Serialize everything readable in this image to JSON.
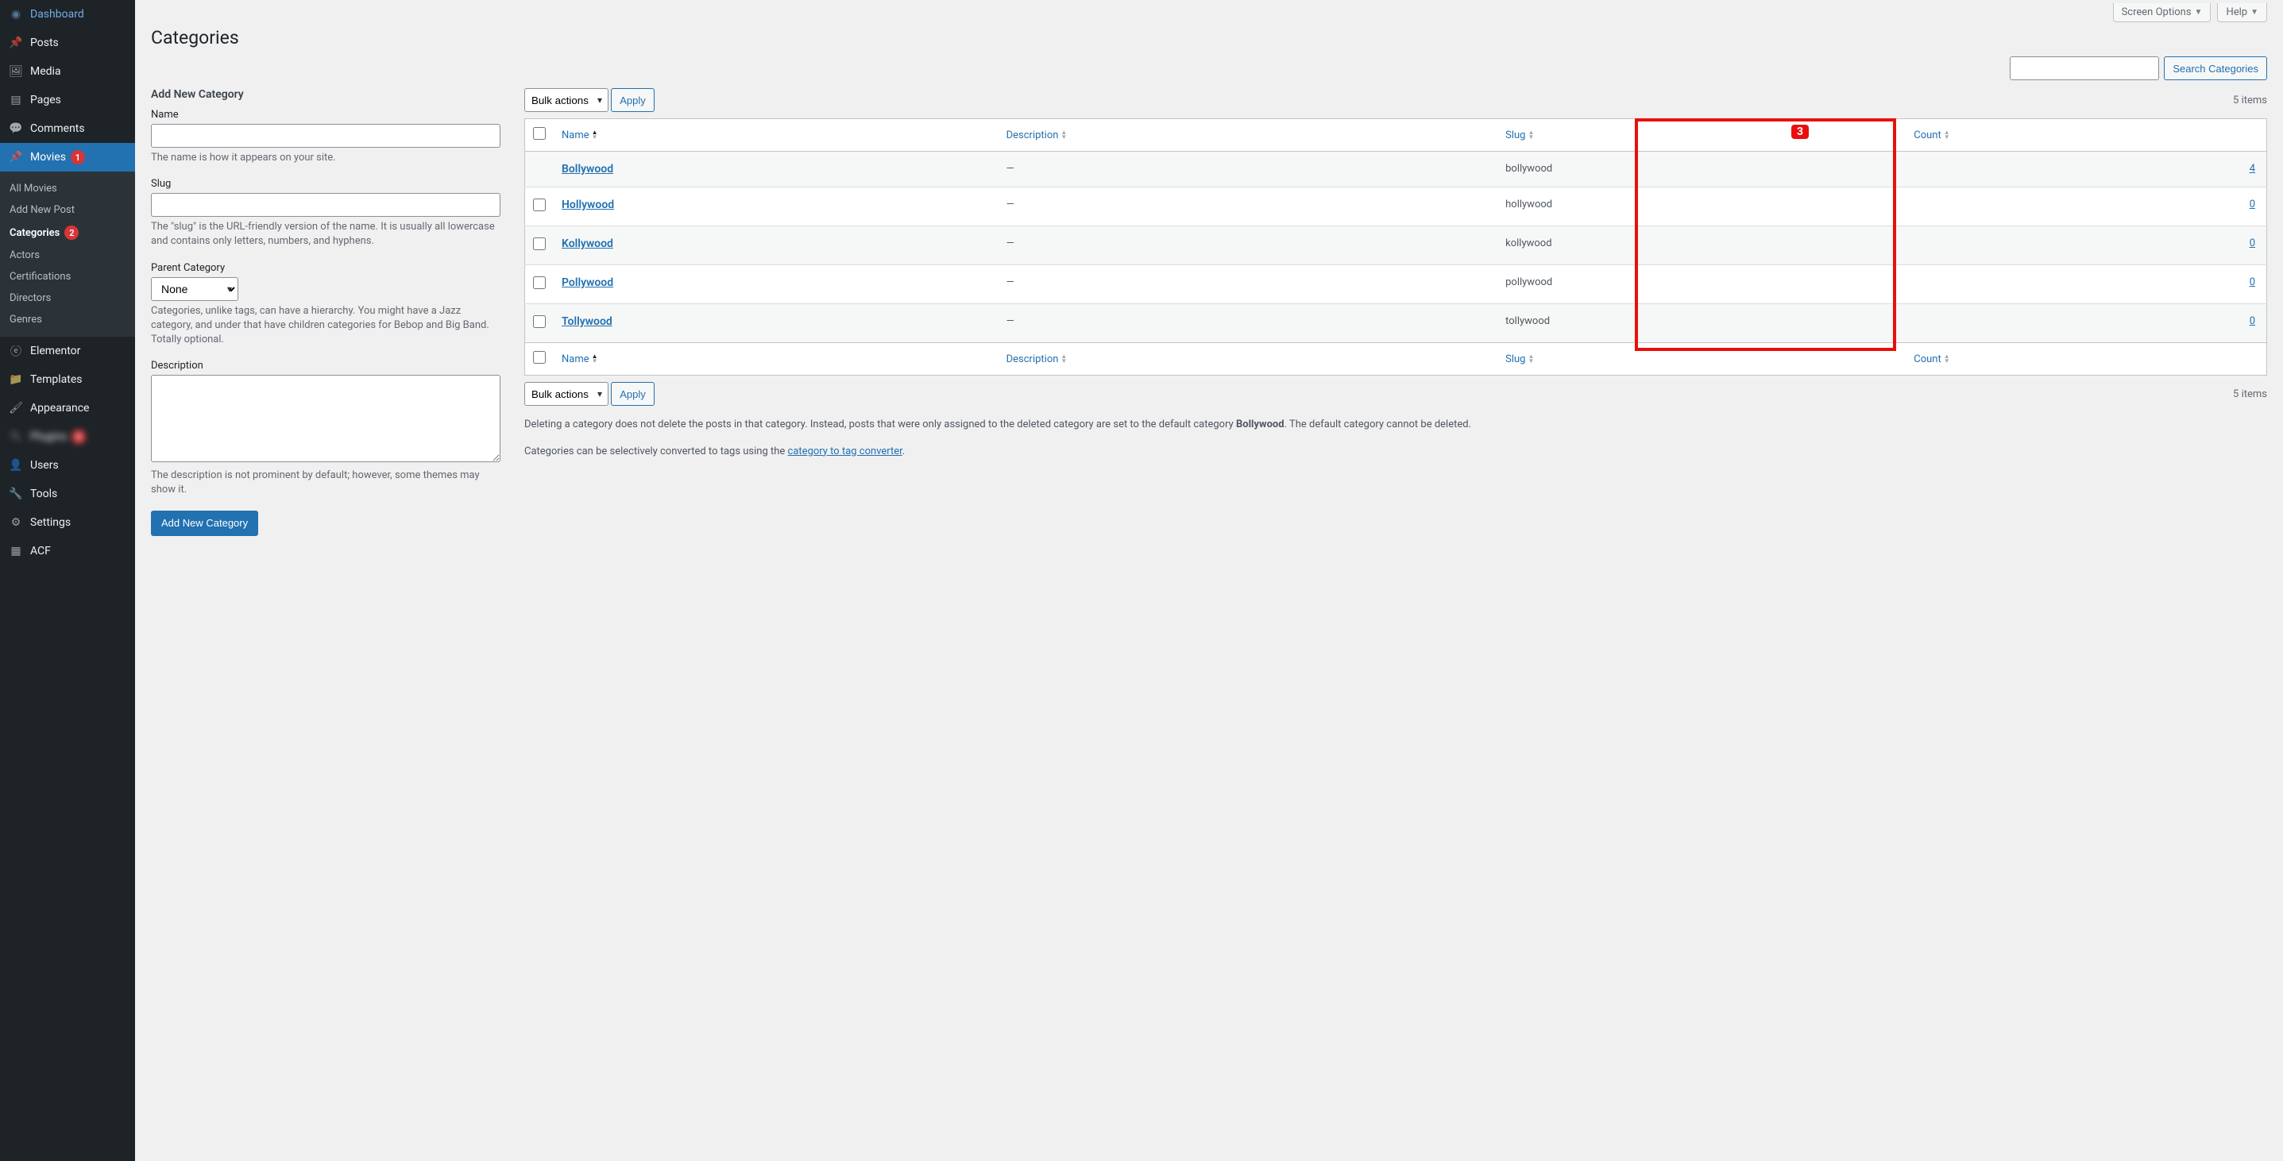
{
  "top": {
    "screen_options": "Screen Options",
    "help": "Help"
  },
  "page_title": "Categories",
  "search": {
    "button": "Search Categories"
  },
  "sidebar": {
    "dashboard": "Dashboard",
    "posts": "Posts",
    "media": "Media",
    "pages": "Pages",
    "comments": "Comments",
    "movies": "Movies",
    "movies_badge": "1",
    "elementor": "Elementor",
    "templates": "Templates",
    "appearance": "Appearance",
    "users": "Users",
    "tools": "Tools",
    "settings": "Settings",
    "acf": "ACF",
    "sub": {
      "all_movies": "All Movies",
      "add_new": "Add New Post",
      "categories": "Categories",
      "categories_badge": "2",
      "actors": "Actors",
      "certifications": "Certifications",
      "directors": "Directors",
      "genres": "Genres"
    }
  },
  "form": {
    "title": "Add New Category",
    "name_label": "Name",
    "name_help": "The name is how it appears on your site.",
    "slug_label": "Slug",
    "slug_help": "The \"slug\" is the URL-friendly version of the name. It is usually all lowercase and contains only letters, numbers, and hyphens.",
    "parent_label": "Parent Category",
    "parent_selected": "None",
    "parent_help": "Categories, unlike tags, can have a hierarchy. You might have a Jazz category, and under that have children categories for Bebop and Big Band. Totally optional.",
    "desc_label": "Description",
    "desc_help": "The description is not prominent by default; however, some themes may show it.",
    "submit": "Add New Category"
  },
  "bulk": {
    "label": "Bulk actions",
    "apply": "Apply"
  },
  "items_count": "5 items",
  "table": {
    "headers": {
      "name": "Name",
      "description": "Description",
      "slug": "Slug",
      "count": "Count"
    },
    "rows": [
      {
        "name": "Bollywood",
        "description": "—",
        "slug": "bollywood",
        "count": "4"
      },
      {
        "name": "Hollywood",
        "description": "—",
        "slug": "hollywood",
        "count": "0"
      },
      {
        "name": "Kollywood",
        "description": "—",
        "slug": "kollywood",
        "count": "0"
      },
      {
        "name": "Pollywood",
        "description": "—",
        "slug": "pollywood",
        "count": "0"
      },
      {
        "name": "Tollywood",
        "description": "—",
        "slug": "tollywood",
        "count": "0"
      }
    ]
  },
  "annotations": {
    "slug_badge": "3"
  },
  "notes": {
    "delete_note_1": "Deleting a category does not delete the posts in that category. Instead, posts that were only assigned to the deleted category are set to the default category ",
    "delete_note_default": "Bollywood",
    "delete_note_2": ". The default category cannot be deleted.",
    "convert_note_1": "Categories can be selectively converted to tags using the ",
    "convert_link": "category to tag converter",
    "convert_note_2": "."
  }
}
